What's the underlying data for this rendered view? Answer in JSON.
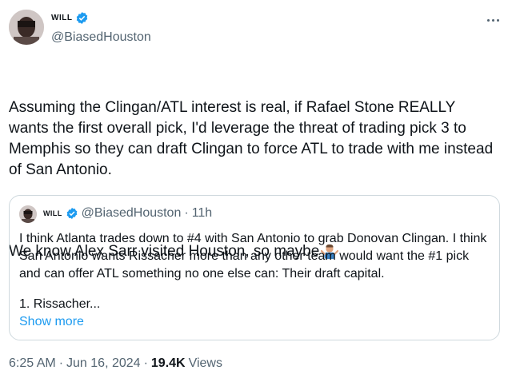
{
  "author": {
    "display_name": "WILL",
    "handle": "@BiasedHouston"
  },
  "tweet": {
    "text_paragraph_1": "Assuming the Clingan/ATL interest is real, if Rafael Stone REALLY wants the first overall pick, I'd leverage the threat of trading pick 3 to Memphis so they can draft Clingan to force ATL to trade with me instead of San Antonio.",
    "text_paragraph_2": "We know Alex Sarr visited Houston, so maybe",
    "emoji": "man-shrugging-emoji"
  },
  "quoted_tweet": {
    "display_name": "WILL",
    "handle": "@BiasedHouston",
    "separator": "·",
    "time_ago": "11h",
    "text": "I think Atlanta trades down to #4 with San Antonio to grab Donovan Clingan. I think San Antonio wants Rissacher more than any other team would want the #1 pick and can offer ATL something no one else can: Their draft capital.",
    "list_preview": "1. Rissacher...",
    "show_more_label": "Show more"
  },
  "meta": {
    "time": "6:25 AM",
    "separator1": "·",
    "date": "Jun 16, 2024",
    "separator2": "·",
    "views_count": "19.4K",
    "views_label": "Views"
  },
  "colors": {
    "verified_blue": "#1d9bf0",
    "secondary_text": "#536471",
    "border": "#cfd9de"
  }
}
